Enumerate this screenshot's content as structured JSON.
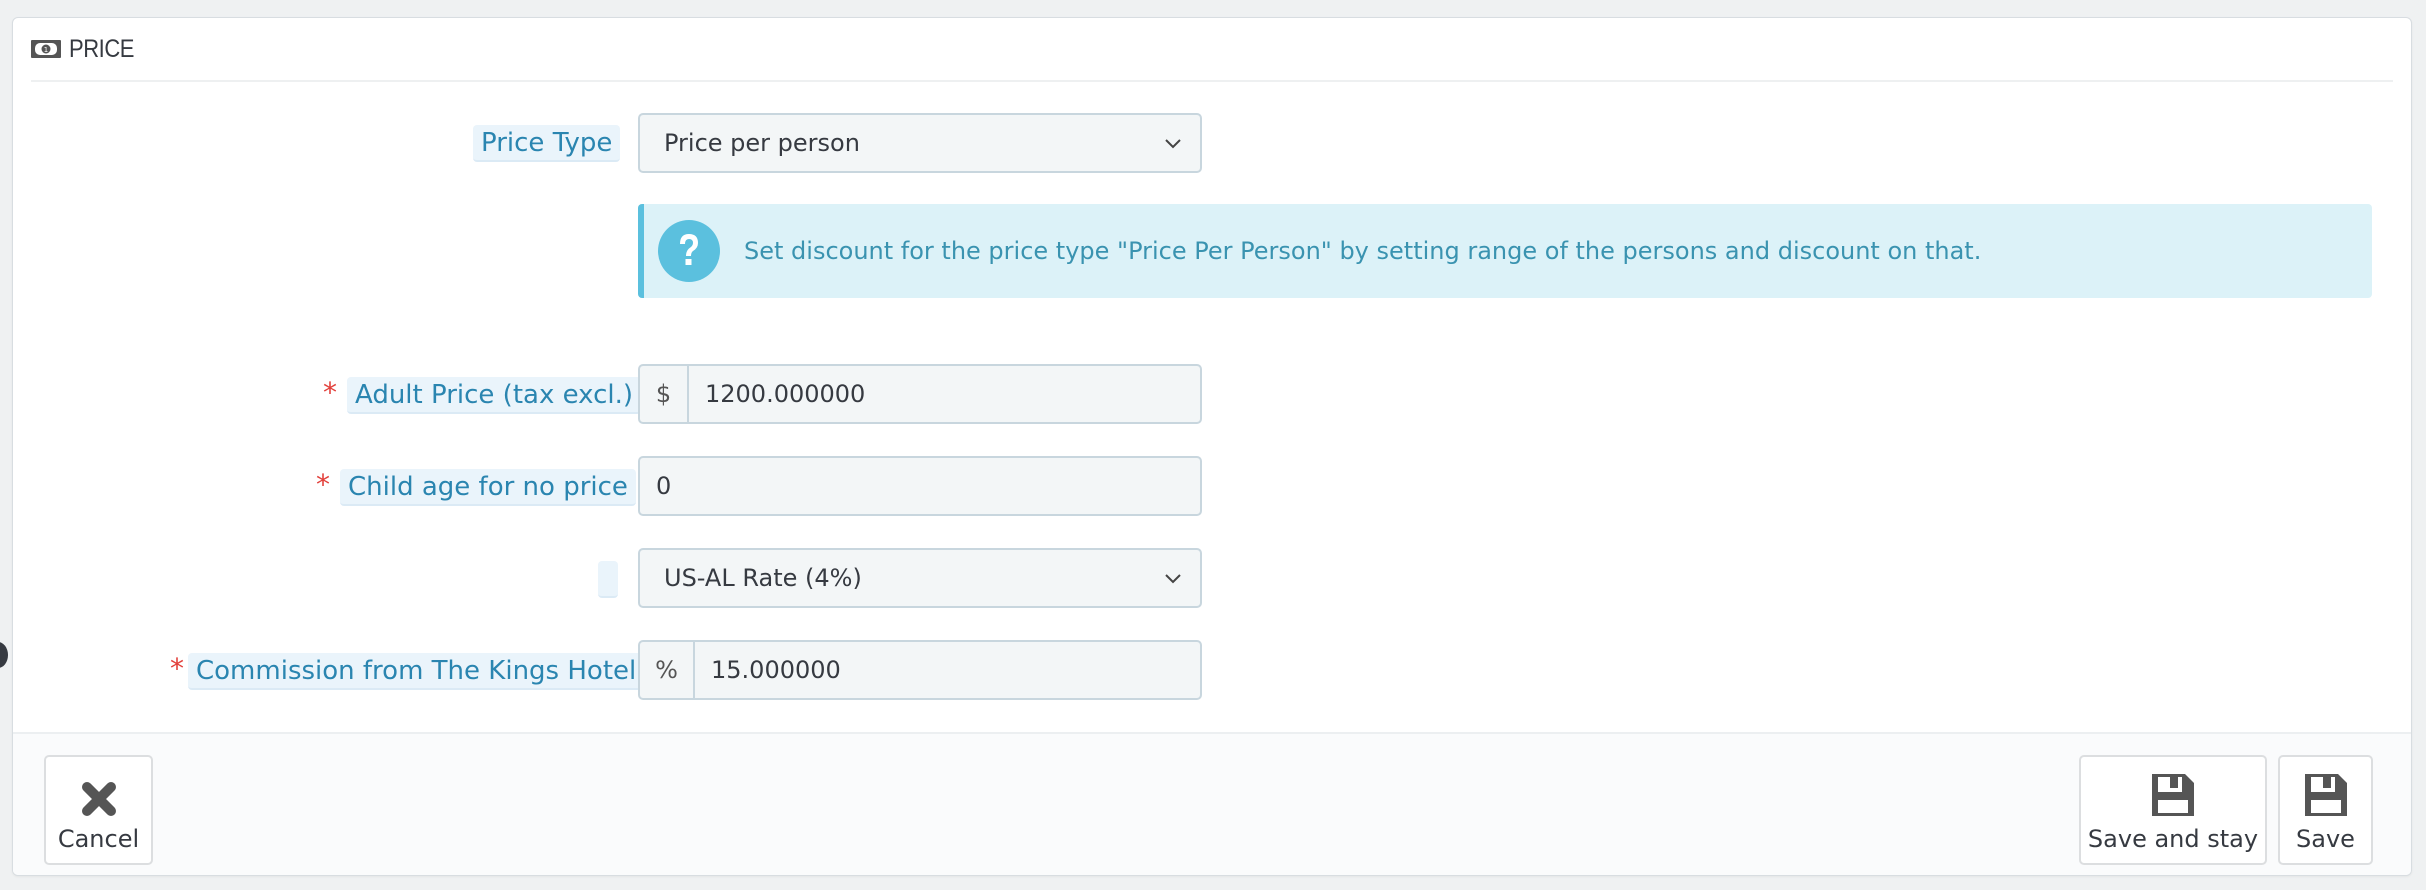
{
  "panel": {
    "title": "PRICE",
    "icon": "money-bill-icon"
  },
  "form": {
    "price_type": {
      "label": "Price Type",
      "value": "Price per person"
    },
    "info": {
      "icon": "question-circle-icon",
      "text": "Set discount for the price type \"Price Per Person\" by setting range of the persons and discount on that."
    },
    "adult_price": {
      "label": "Adult Price (tax excl.)",
      "required": "*",
      "prefix": "$",
      "value": "1200.000000"
    },
    "child_age": {
      "label": "Child age for no price",
      "required": "*",
      "value": "0"
    },
    "tax_rule": {
      "label": "",
      "value": "US-AL Rate (4%)"
    },
    "commission": {
      "label": "Commission from The Kings Hotel",
      "required": "*",
      "prefix": "%",
      "value": "15.000000"
    }
  },
  "footer": {
    "cancel_label": "Cancel",
    "save_and_stay_label": "Save and stay",
    "save_label": "Save"
  },
  "colors": {
    "label_text": "#2a85b0",
    "required": "#e2403b",
    "info_bg": "#dcf2f8",
    "info_accent": "#5bc0de"
  }
}
